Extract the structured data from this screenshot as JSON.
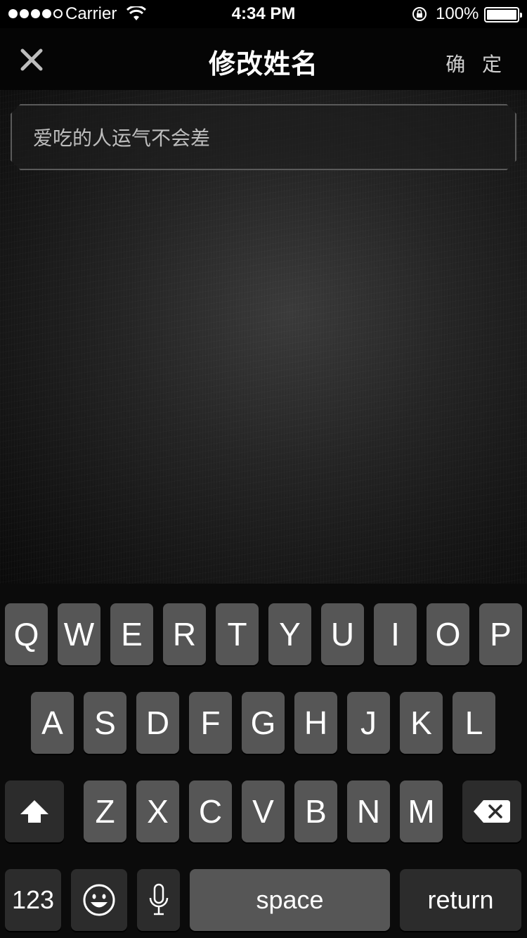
{
  "status_bar": {
    "carrier": "Carrier",
    "time": "4:34 PM",
    "battery": "100%",
    "icons": [
      "signal-icon",
      "wifi-icon",
      "rotation-lock-icon",
      "battery-icon"
    ]
  },
  "nav": {
    "title": "修改姓名",
    "confirm": "确 定",
    "close_icon": "close-icon"
  },
  "name_field": {
    "value": "爱吃的人运气不会差"
  },
  "keyboard": {
    "row1": [
      "Q",
      "W",
      "E",
      "R",
      "T",
      "Y",
      "U",
      "I",
      "O",
      "P"
    ],
    "row2": [
      "A",
      "S",
      "D",
      "F",
      "G",
      "H",
      "J",
      "K",
      "L"
    ],
    "row3": [
      "Z",
      "X",
      "C",
      "V",
      "B",
      "N",
      "M"
    ],
    "numbers": "123",
    "space": "space",
    "return": "return",
    "icons": [
      "shift-icon",
      "backspace-icon",
      "emoji-icon",
      "microphone-icon"
    ]
  },
  "colors": {
    "key": "#565656",
    "key_dark": "#2c2c2c",
    "background": "#000000"
  }
}
